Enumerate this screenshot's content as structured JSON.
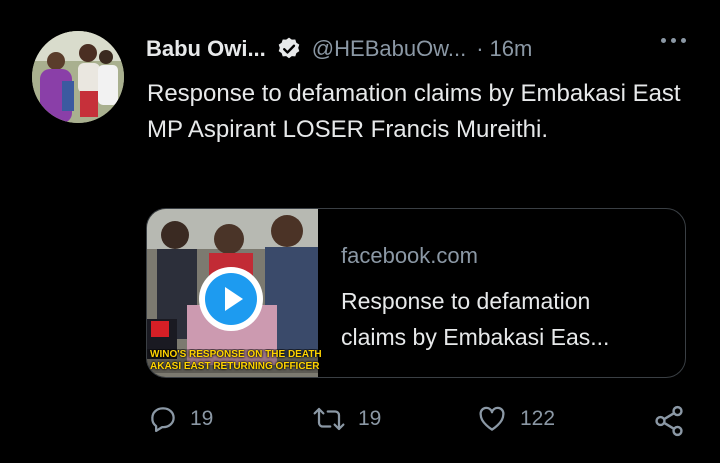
{
  "tweet": {
    "display_name": "Babu Owi...",
    "handle": "@HEBabuOw...",
    "separator": "·",
    "timestamp": "16m",
    "text": "Response to defamation claims by Embakasi East MP Aspirant LOSER Francis Mureithi.",
    "verified": true
  },
  "card": {
    "domain": "facebook.com",
    "title": "Response to defamation claims by Embakasi Eas...",
    "caption_line1": "WINO'S RESPONSE ON THE DEATH",
    "caption_line2": "AKASI EAST RETURNING OFFICER"
  },
  "actions": {
    "replies": "19",
    "retweets": "19",
    "likes": "122"
  },
  "colors": {
    "background": "#000000",
    "text_primary": "#e7e9ea",
    "text_secondary": "#8b98a5",
    "accent": "#1d9bf0",
    "caption": "#ffd400"
  }
}
